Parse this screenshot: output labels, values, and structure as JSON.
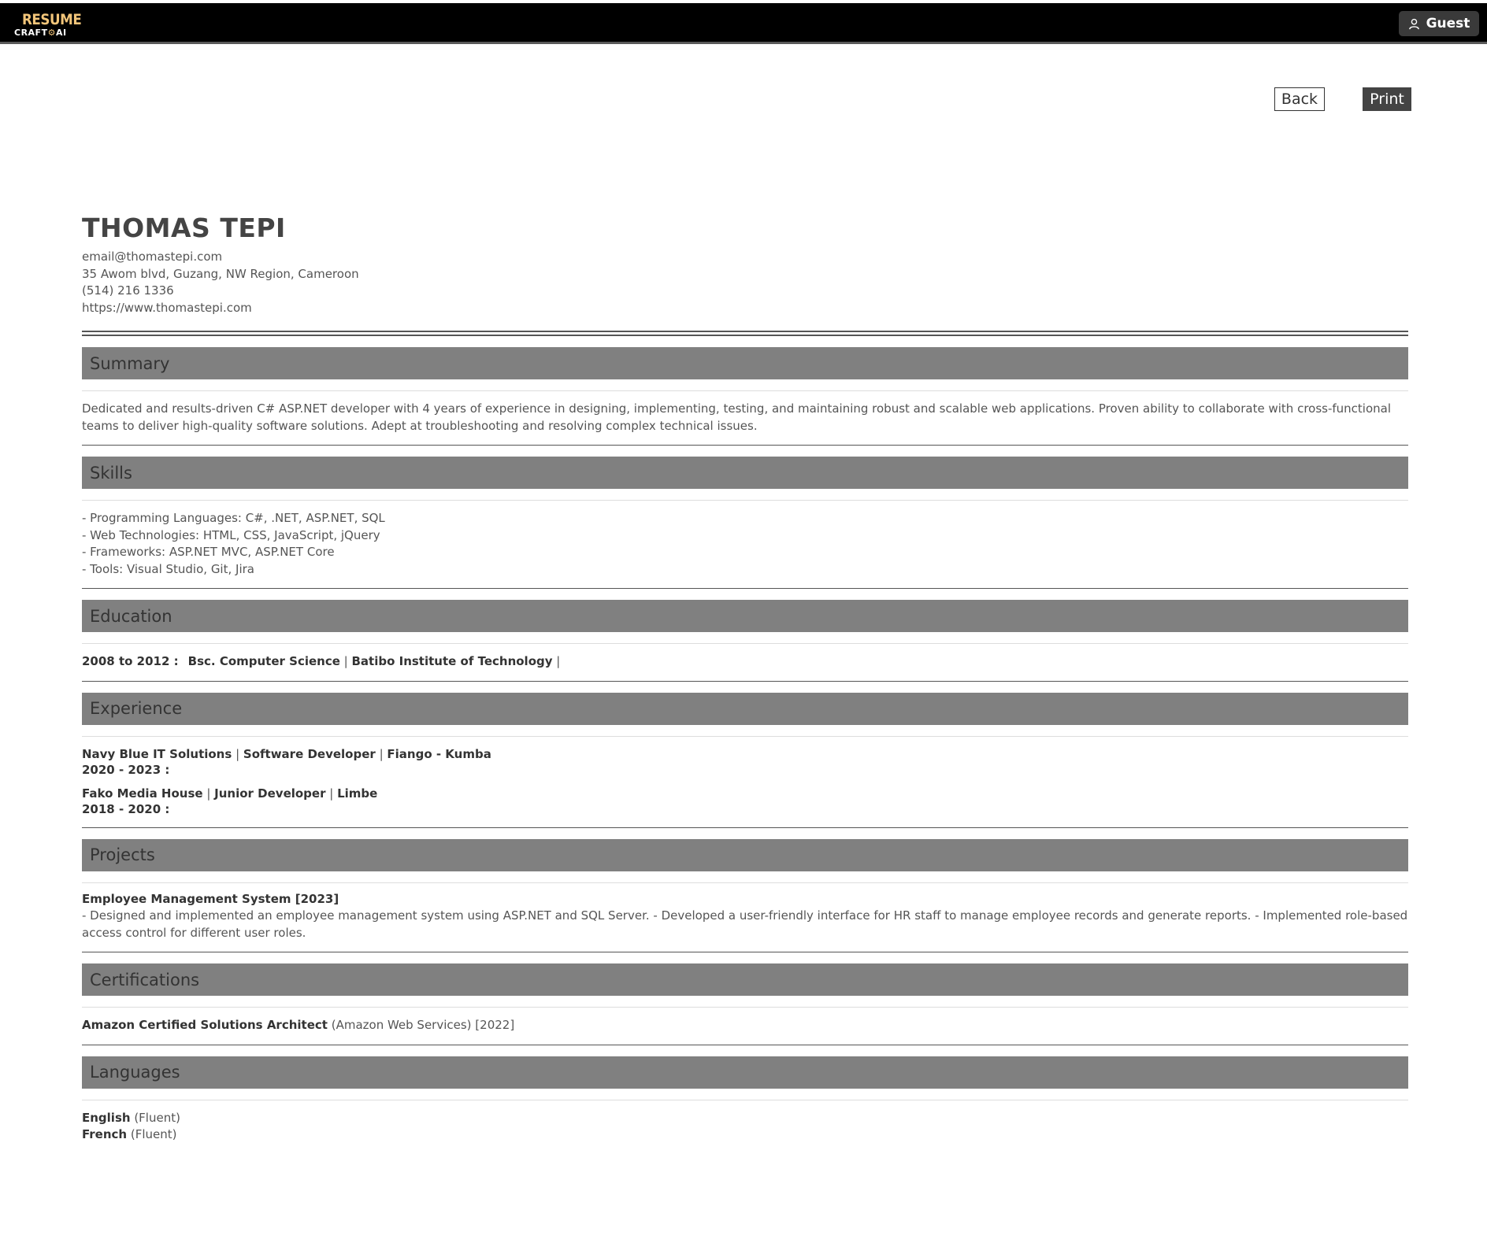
{
  "header": {
    "logo_top": "RESUME",
    "logo_bottom_left": "CRAFT",
    "logo_bottom_right": "AI",
    "guest_label": "Guest"
  },
  "actions": {
    "back_label": "Back",
    "print_label": "Print"
  },
  "resume": {
    "name": "THOMAS TEPI",
    "email": "email@thomastepi.com",
    "address": "35 Awom blvd, Guzang, NW Region, Cameroon",
    "phone": "(514) 216 1336",
    "website": "https://www.thomastepi.com",
    "summary": {
      "title": "Summary",
      "text": "Dedicated and results-driven C# ASP.NET developer with 4 years of experience in designing, implementing, testing, and maintaining robust and scalable web applications. Proven ability to collaborate with cross-functional teams to deliver high-quality software solutions. Adept at troubleshooting and resolving complex technical issues."
    },
    "skills": {
      "title": "Skills",
      "items": [
        "- Programming Languages: C#, .NET, ASP.NET, SQL",
        "- Web Technologies: HTML, CSS, JavaScript, jQuery",
        "- Frameworks: ASP.NET MVC, ASP.NET Core",
        "- Tools: Visual Studio, Git, Jira"
      ]
    },
    "education": {
      "title": "Education",
      "entries": [
        {
          "dates": "2008 to 2012 :",
          "degree": "Bsc. Computer Science",
          "sep1": " | ",
          "school": "Batibo Institute of Technology",
          "sep2": " |"
        }
      ]
    },
    "experience": {
      "title": "Experience",
      "entries": [
        {
          "company": "Navy Blue IT Solutions",
          "role": "Software Developer",
          "location": "Fiango - Kumba",
          "dates": "2020 - 2023 :"
        },
        {
          "company": "Fako Media House",
          "role": "Junior Developer",
          "location": "Limbe",
          "dates": "2018 - 2020 :"
        }
      ],
      "separator": " | "
    },
    "projects": {
      "title": "Projects",
      "entries": [
        {
          "name": "Employee Management System [2023]",
          "description": "- Designed and implemented an employee management system using ASP.NET and SQL Server. - Developed a user-friendly interface for HR staff to manage employee records and generate reports. - Implemented role-based access control for different user roles."
        }
      ]
    },
    "certifications": {
      "title": "Certifications",
      "entries": [
        {
          "name": "Amazon Certified Solutions Architect",
          "issuer": " (Amazon Web Services) [2022]"
        }
      ]
    },
    "languages": {
      "title": "Languages",
      "entries": [
        {
          "language": "English",
          "level": " (Fluent)"
        },
        {
          "language": "French",
          "level": " (Fluent)"
        }
      ]
    }
  }
}
